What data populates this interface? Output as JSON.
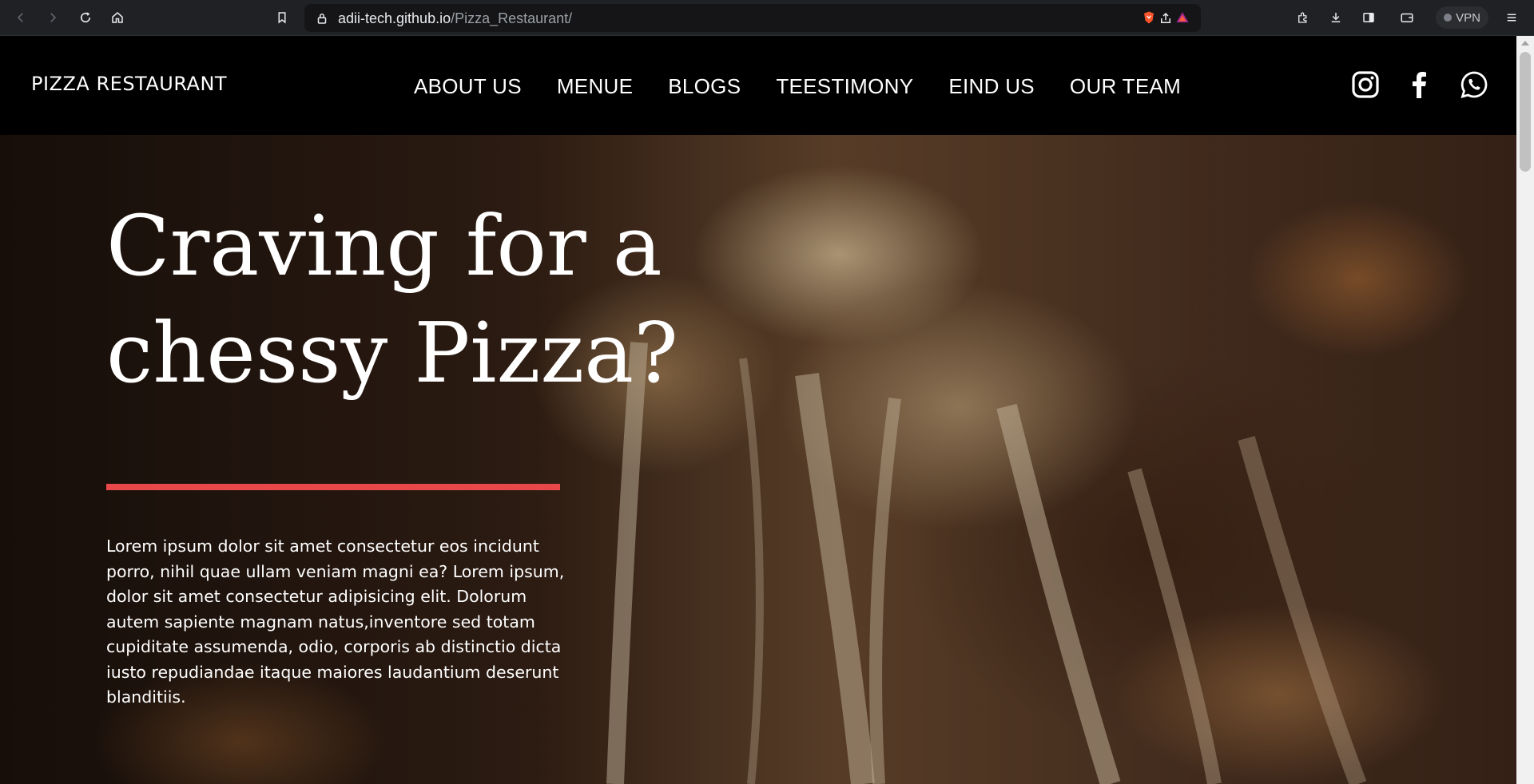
{
  "browser": {
    "url_host": "adii-tech.github.io",
    "url_path": "/Pizza_Restaurant/",
    "vpn_label": "VPN",
    "icons": [
      "back-icon",
      "forward-icon",
      "reload-icon",
      "home-icon",
      "bookmark-icon",
      "lock-icon",
      "share-icon",
      "brave-shield-icon",
      "brave-rewards-icon",
      "extensions-icon",
      "downloads-icon",
      "sidebar-icon",
      "wallet-icon",
      "menu-icon"
    ]
  },
  "navbar": {
    "brand": "PIZZA RESTAURANT",
    "links": [
      "ABOUT US",
      "MENUE",
      "BLOGS",
      "TEESTIMONY",
      "EIND US",
      "OUR TEAM"
    ],
    "socials": [
      "instagram-icon",
      "facebook-icon",
      "whatsapp-icon"
    ]
  },
  "hero": {
    "headline_line1": "Craving for a",
    "headline_line2": "chessy Pizza?",
    "accent_color": "#e8484a",
    "paragraph": "Lorem ipsum dolor sit amet consectetur eos incidunt porro, nihil quae ullam veniam magni ea? Lorem ipsum, dolor sit amet consectetur adipisicing elit. Dolorum autem sapiente magnam natus,inventore sed totam cupiditate assumenda, odio, corporis ab distinctio dicta iusto repudiandae itaque maiores laudantium deserunt blanditiis."
  }
}
